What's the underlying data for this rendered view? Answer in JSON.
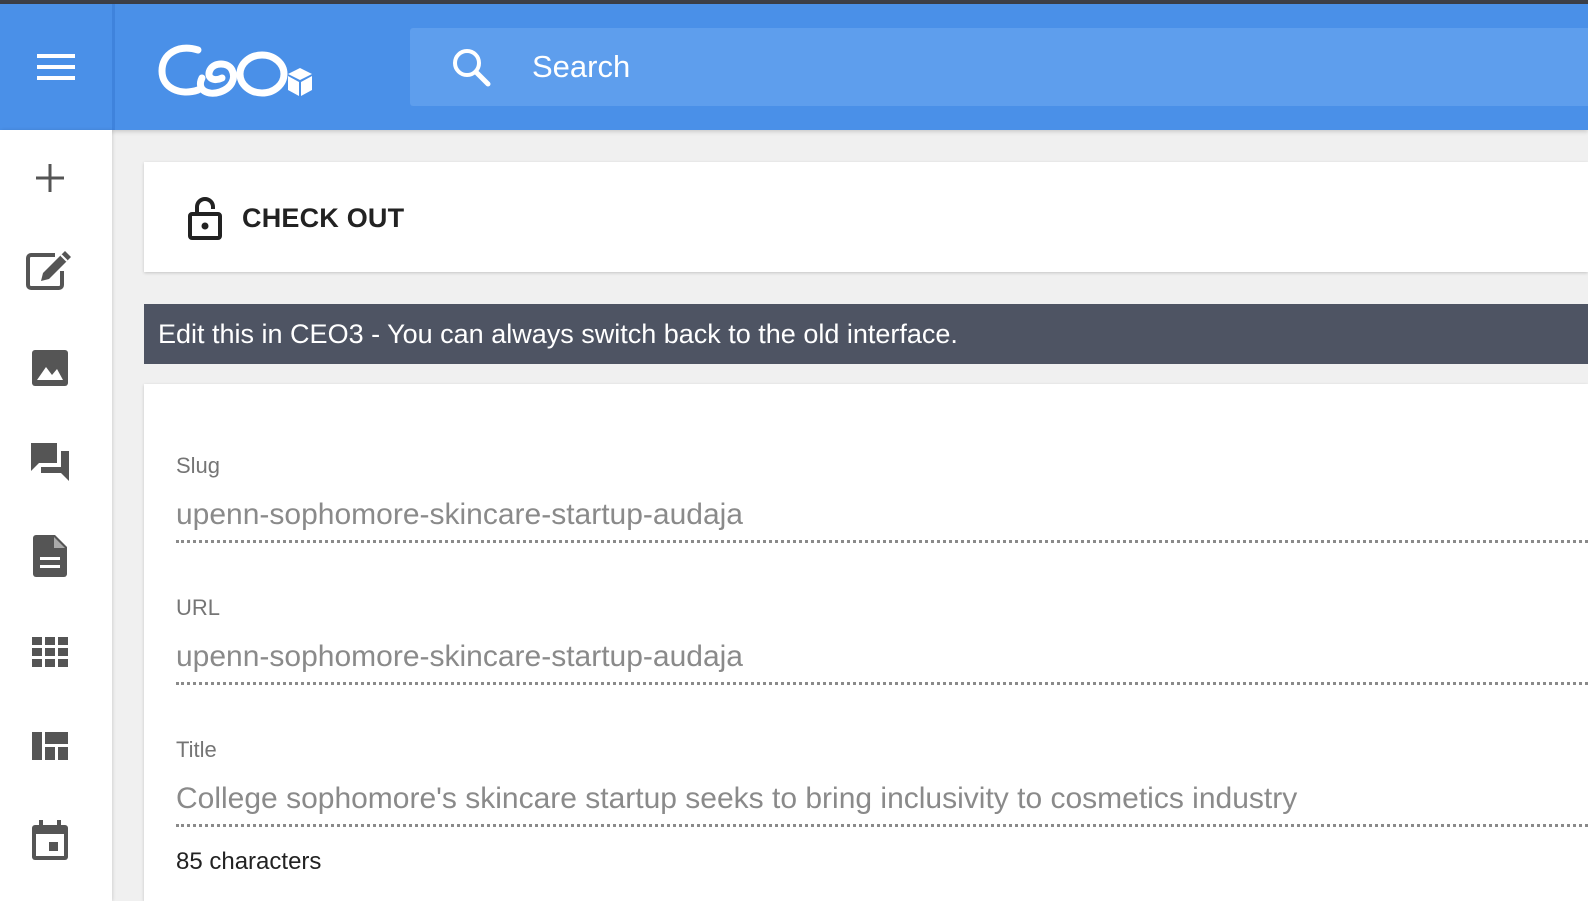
{
  "header": {
    "search_placeholder": "Search"
  },
  "checkout": {
    "label": "CHECK OUT"
  },
  "banner": {
    "text": "Edit this in CEO3 - You can always switch back to the old interface."
  },
  "form": {
    "slug": {
      "label": "Slug",
      "value": "upenn-sophomore-skincare-startup-audaja"
    },
    "url": {
      "label": "URL",
      "value": "upenn-sophomore-skincare-startup-audaja"
    },
    "title": {
      "label": "Title",
      "value": "College sophomore's skincare startup seeks to bring inclusivity to cosmetics industry"
    },
    "title_count": "85 characters"
  },
  "sidebar": {
    "icons": [
      "plus-icon",
      "edit-icon",
      "image-icon",
      "forum-icon",
      "document-icon",
      "grid-icon",
      "dashboard-icon",
      "calendar-icon"
    ]
  },
  "colors": {
    "header": "#4a90e8",
    "search": "#5e9eed",
    "banner": "#4e5463",
    "background": "#f0f0f0"
  }
}
